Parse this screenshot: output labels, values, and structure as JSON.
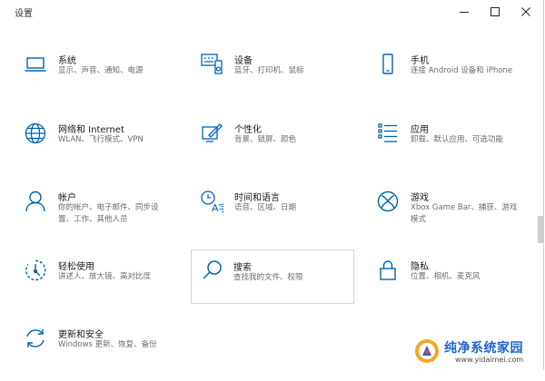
{
  "window": {
    "title": "设置",
    "accent": "#0063b1"
  },
  "tiles": [
    {
      "title": "系统",
      "desc": "显示、声音、通知、电源",
      "icon": "laptop-icon"
    },
    {
      "title": "设备",
      "desc": "蓝牙、打印机、鼠标",
      "icon": "keyboard-devices-icon"
    },
    {
      "title": "手机",
      "desc": "连接 Android 设备和 iPhone",
      "icon": "phone-icon"
    },
    {
      "title": "网络和 Internet",
      "desc": "WLAN、飞行模式、VPN",
      "icon": "globe-icon"
    },
    {
      "title": "个性化",
      "desc": "背景、锁屏、颜色",
      "icon": "paint-pen-icon"
    },
    {
      "title": "应用",
      "desc": "卸载、默认应用、可选功能",
      "icon": "app-list-icon"
    },
    {
      "title": "帐户",
      "desc": "你的帐户、电子邮件、同步设置、工作、其他人员",
      "icon": "person-icon"
    },
    {
      "title": "时间和语言",
      "desc": "语音、区域、日期",
      "icon": "time-language-icon"
    },
    {
      "title": "游戏",
      "desc": "Xbox Game Bar、捕获、游戏模式",
      "icon": "xbox-icon"
    },
    {
      "title": "轻松使用",
      "desc": "讲述人、放大镜、高对比度",
      "icon": "ease-of-access-icon"
    },
    {
      "title": "搜索",
      "desc": "查找我的文件、权限",
      "icon": "search-icon"
    },
    {
      "title": "隐私",
      "desc": "位置、相机、麦克风",
      "icon": "lock-icon"
    },
    {
      "title": "更新和安全",
      "desc": "Windows 更新、恢复、备份",
      "icon": "update-sync-icon"
    }
  ],
  "watermark": {
    "name": "纯净系统家园",
    "url": "www.yidaimei.com"
  }
}
